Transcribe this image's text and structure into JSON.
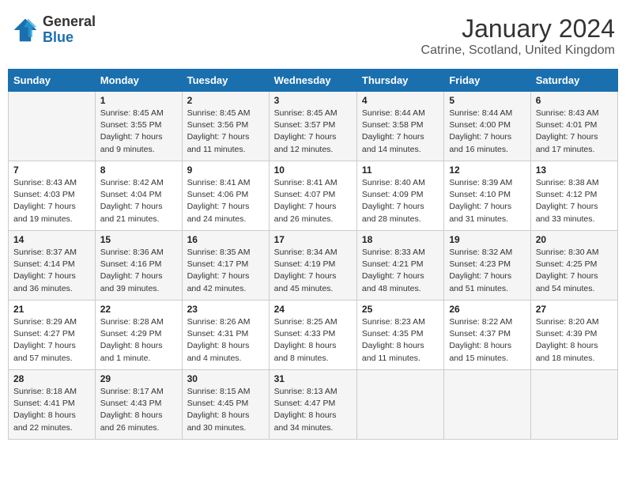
{
  "header": {
    "logo_general": "General",
    "logo_blue": "Blue",
    "month_title": "January 2024",
    "location": "Catrine, Scotland, United Kingdom"
  },
  "days_of_week": [
    "Sunday",
    "Monday",
    "Tuesday",
    "Wednesday",
    "Thursday",
    "Friday",
    "Saturday"
  ],
  "weeks": [
    [
      {
        "day": "",
        "info": ""
      },
      {
        "day": "1",
        "info": "Sunrise: 8:45 AM\nSunset: 3:55 PM\nDaylight: 7 hours\nand 9 minutes."
      },
      {
        "day": "2",
        "info": "Sunrise: 8:45 AM\nSunset: 3:56 PM\nDaylight: 7 hours\nand 11 minutes."
      },
      {
        "day": "3",
        "info": "Sunrise: 8:45 AM\nSunset: 3:57 PM\nDaylight: 7 hours\nand 12 minutes."
      },
      {
        "day": "4",
        "info": "Sunrise: 8:44 AM\nSunset: 3:58 PM\nDaylight: 7 hours\nand 14 minutes."
      },
      {
        "day": "5",
        "info": "Sunrise: 8:44 AM\nSunset: 4:00 PM\nDaylight: 7 hours\nand 16 minutes."
      },
      {
        "day": "6",
        "info": "Sunrise: 8:43 AM\nSunset: 4:01 PM\nDaylight: 7 hours\nand 17 minutes."
      }
    ],
    [
      {
        "day": "7",
        "info": "Sunrise: 8:43 AM\nSunset: 4:03 PM\nDaylight: 7 hours\nand 19 minutes."
      },
      {
        "day": "8",
        "info": "Sunrise: 8:42 AM\nSunset: 4:04 PM\nDaylight: 7 hours\nand 21 minutes."
      },
      {
        "day": "9",
        "info": "Sunrise: 8:41 AM\nSunset: 4:06 PM\nDaylight: 7 hours\nand 24 minutes."
      },
      {
        "day": "10",
        "info": "Sunrise: 8:41 AM\nSunset: 4:07 PM\nDaylight: 7 hours\nand 26 minutes."
      },
      {
        "day": "11",
        "info": "Sunrise: 8:40 AM\nSunset: 4:09 PM\nDaylight: 7 hours\nand 28 minutes."
      },
      {
        "day": "12",
        "info": "Sunrise: 8:39 AM\nSunset: 4:10 PM\nDaylight: 7 hours\nand 31 minutes."
      },
      {
        "day": "13",
        "info": "Sunrise: 8:38 AM\nSunset: 4:12 PM\nDaylight: 7 hours\nand 33 minutes."
      }
    ],
    [
      {
        "day": "14",
        "info": "Sunrise: 8:37 AM\nSunset: 4:14 PM\nDaylight: 7 hours\nand 36 minutes."
      },
      {
        "day": "15",
        "info": "Sunrise: 8:36 AM\nSunset: 4:16 PM\nDaylight: 7 hours\nand 39 minutes."
      },
      {
        "day": "16",
        "info": "Sunrise: 8:35 AM\nSunset: 4:17 PM\nDaylight: 7 hours\nand 42 minutes."
      },
      {
        "day": "17",
        "info": "Sunrise: 8:34 AM\nSunset: 4:19 PM\nDaylight: 7 hours\nand 45 minutes."
      },
      {
        "day": "18",
        "info": "Sunrise: 8:33 AM\nSunset: 4:21 PM\nDaylight: 7 hours\nand 48 minutes."
      },
      {
        "day": "19",
        "info": "Sunrise: 8:32 AM\nSunset: 4:23 PM\nDaylight: 7 hours\nand 51 minutes."
      },
      {
        "day": "20",
        "info": "Sunrise: 8:30 AM\nSunset: 4:25 PM\nDaylight: 7 hours\nand 54 minutes."
      }
    ],
    [
      {
        "day": "21",
        "info": "Sunrise: 8:29 AM\nSunset: 4:27 PM\nDaylight: 7 hours\nand 57 minutes."
      },
      {
        "day": "22",
        "info": "Sunrise: 8:28 AM\nSunset: 4:29 PM\nDaylight: 8 hours\nand 1 minute."
      },
      {
        "day": "23",
        "info": "Sunrise: 8:26 AM\nSunset: 4:31 PM\nDaylight: 8 hours\nand 4 minutes."
      },
      {
        "day": "24",
        "info": "Sunrise: 8:25 AM\nSunset: 4:33 PM\nDaylight: 8 hours\nand 8 minutes."
      },
      {
        "day": "25",
        "info": "Sunrise: 8:23 AM\nSunset: 4:35 PM\nDaylight: 8 hours\nand 11 minutes."
      },
      {
        "day": "26",
        "info": "Sunrise: 8:22 AM\nSunset: 4:37 PM\nDaylight: 8 hours\nand 15 minutes."
      },
      {
        "day": "27",
        "info": "Sunrise: 8:20 AM\nSunset: 4:39 PM\nDaylight: 8 hours\nand 18 minutes."
      }
    ],
    [
      {
        "day": "28",
        "info": "Sunrise: 8:18 AM\nSunset: 4:41 PM\nDaylight: 8 hours\nand 22 minutes."
      },
      {
        "day": "29",
        "info": "Sunrise: 8:17 AM\nSunset: 4:43 PM\nDaylight: 8 hours\nand 26 minutes."
      },
      {
        "day": "30",
        "info": "Sunrise: 8:15 AM\nSunset: 4:45 PM\nDaylight: 8 hours\nand 30 minutes."
      },
      {
        "day": "31",
        "info": "Sunrise: 8:13 AM\nSunset: 4:47 PM\nDaylight: 8 hours\nand 34 minutes."
      },
      {
        "day": "",
        "info": ""
      },
      {
        "day": "",
        "info": ""
      },
      {
        "day": "",
        "info": ""
      }
    ]
  ]
}
